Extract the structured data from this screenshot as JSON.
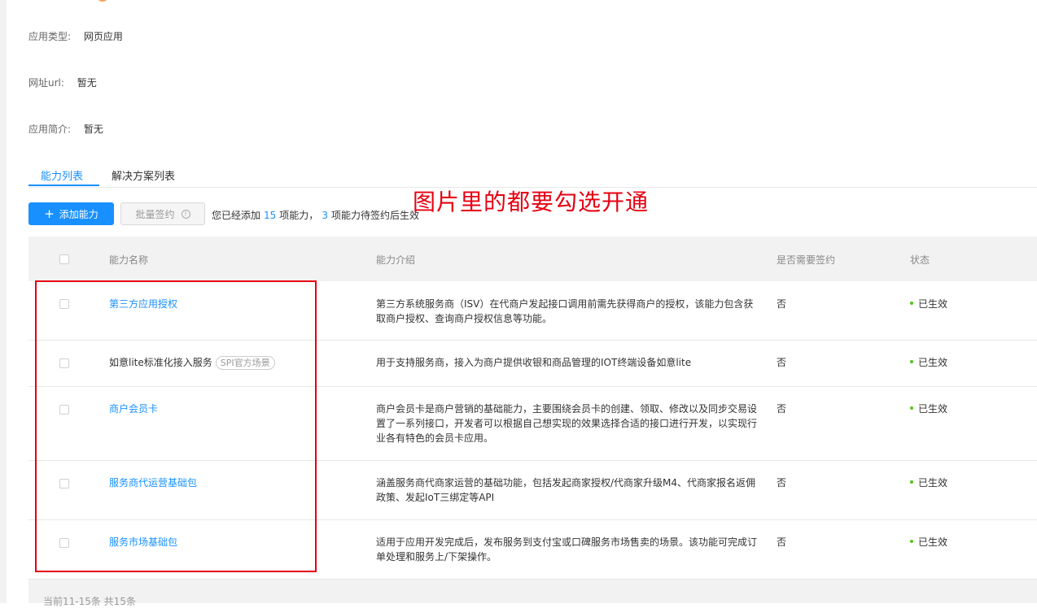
{
  "info": [
    {
      "label": "应用类型:",
      "value": "网页应用"
    },
    {
      "label": "网址url:",
      "value": "暂无"
    },
    {
      "label": "应用简介:",
      "value": "暂无"
    }
  ],
  "tabs": [
    "能力列表",
    "解决方案列表"
  ],
  "toolbar": {
    "add_label": "添加能力",
    "batch_label": "批量签约",
    "summary_pre": "您已经添加",
    "added_count": "15",
    "summary_mid": "项能力，",
    "pending_count": "3",
    "summary_post": "项能力待签约后生效"
  },
  "annotation": "图片里的都要勾选开通",
  "table": {
    "headers": [
      "能力名称",
      "能力介绍",
      "是否需要签约",
      "状态"
    ],
    "rows": [
      {
        "name": "第三方应用授权",
        "tag": "",
        "desc": "第三方系统服务商（ISV）在代商户发起接口调用前需先获得商户的授权，该能力包含获取商户授权、查询商户授权信息等功能。",
        "sign": "否",
        "status": "已生效"
      },
      {
        "name": "如意lite标准化接入服务",
        "tag": "SPI官方场景",
        "desc": "用于支持服务商，接入为商户提供收银和商品管理的IOT终端设备如意lite",
        "sign": "否",
        "status": "已生效"
      },
      {
        "name": "商户会员卡",
        "tag": "",
        "desc": "商户会员卡是商户营销的基础能力，主要围绕会员卡的创建、领取、修改以及同步交易设置了一系列接口，开发者可以根据自己想实现的效果选择合适的接口进行开发，以实现行业各有特色的会员卡应用。",
        "sign": "否",
        "status": "已生效"
      },
      {
        "name": "服务商代运营基础包",
        "tag": "",
        "desc": "涵盖服务商代商家运营的基础功能，包括发起商家授权/代商家升级M4、代商家报名返佣政策、发起IoT三绑定等API",
        "sign": "否",
        "status": "已生效"
      },
      {
        "name": "服务市场基础包",
        "tag": "",
        "desc": "适用于应用开发完成后，发布服务到支付宝或口碑服务市场售卖的场景。该功能可完成订单处理和服务上/下架操作。",
        "sign": "否",
        "status": "已生效"
      }
    ]
  },
  "footer": {
    "text": "当前11-15条 共15条"
  },
  "colors": {
    "accent": "#1890ff",
    "annotation": "#e60012",
    "status_dot": "#52c41a"
  }
}
